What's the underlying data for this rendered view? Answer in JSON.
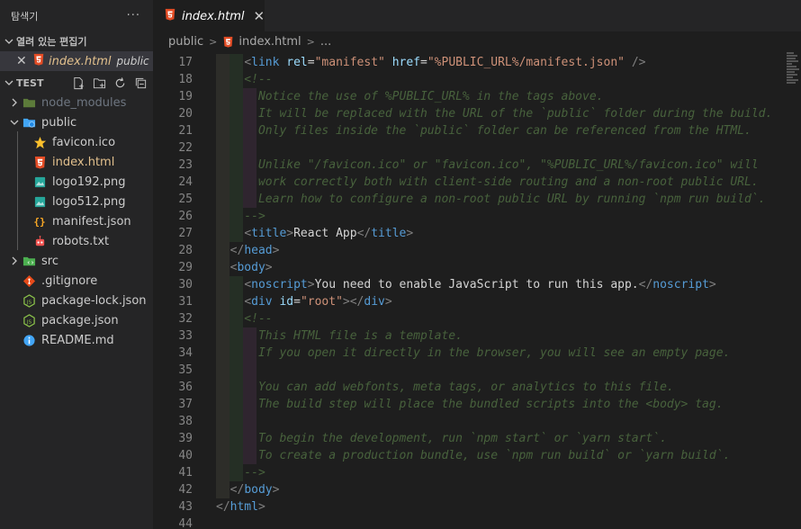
{
  "sidebar": {
    "title": "탐색기",
    "more": "···",
    "open_editors": {
      "label": "열려 있는 편집기",
      "items": [
        {
          "name": "index.html",
          "folder": "public"
        }
      ]
    },
    "workspace": "TEST",
    "tree": [
      {
        "label": "node_modules",
        "type": "folder",
        "expanded": false,
        "dim": true
      },
      {
        "label": "public",
        "type": "folder",
        "expanded": true
      },
      {
        "label": "favicon.ico",
        "type": "favicon"
      },
      {
        "label": "index.html",
        "type": "html",
        "selected": true
      },
      {
        "label": "logo192.png",
        "type": "image"
      },
      {
        "label": "logo512.png",
        "type": "image"
      },
      {
        "label": "manifest.json",
        "type": "json"
      },
      {
        "label": "robots.txt",
        "type": "robots"
      },
      {
        "label": "src",
        "type": "folder",
        "expanded": false
      },
      {
        "label": ".gitignore",
        "type": "git"
      },
      {
        "label": "package-lock.json",
        "type": "node"
      },
      {
        "label": "package.json",
        "type": "node"
      },
      {
        "label": "README.md",
        "type": "info"
      }
    ]
  },
  "editor": {
    "tab": {
      "name": "index.html",
      "close": "✕"
    },
    "breadcrumbs": {
      "folder": "public",
      "file": "index.html",
      "ellipsis": "..."
    },
    "lines": [
      {
        "n": "17",
        "indent": 2,
        "seg": [
          [
            "    ",
            "t"
          ],
          [
            "<",
            "br"
          ],
          [
            "link",
            "tag"
          ],
          [
            " ",
            "t"
          ],
          [
            "rel",
            "attr"
          ],
          [
            "=",
            "t"
          ],
          [
            "\"manifest\"",
            "str"
          ],
          [
            " ",
            "t"
          ],
          [
            "href",
            "attr"
          ],
          [
            "=",
            "t"
          ],
          [
            "\"%PUBLIC_URL%/manifest.json\"",
            "str"
          ],
          [
            " ",
            "t"
          ],
          [
            "/>",
            "br"
          ]
        ]
      },
      {
        "n": "18",
        "indent": 2,
        "seg": [
          [
            "    <!--",
            "cm"
          ]
        ]
      },
      {
        "n": "19",
        "indent": 3,
        "seg": [
          [
            "      Notice the use of %PUBLIC_URL% in the tags above.",
            "cm"
          ]
        ]
      },
      {
        "n": "20",
        "indent": 3,
        "seg": [
          [
            "      It will be replaced with the URL of the `public` folder during the build.",
            "cm"
          ]
        ]
      },
      {
        "n": "21",
        "indent": 3,
        "seg": [
          [
            "      Only files inside the `public` folder can be referenced from the HTML.",
            "cm"
          ]
        ]
      },
      {
        "n": "22",
        "indent": 3,
        "seg": [
          [
            "",
            "t"
          ]
        ]
      },
      {
        "n": "23",
        "indent": 3,
        "seg": [
          [
            "      Unlike \"/favicon.ico\" or \"favicon.ico\", \"%PUBLIC_URL%/favicon.ico\" will",
            "cm"
          ]
        ]
      },
      {
        "n": "24",
        "indent": 3,
        "seg": [
          [
            "      work correctly both with client-side routing and a non-root public URL.",
            "cm"
          ]
        ]
      },
      {
        "n": "25",
        "indent": 3,
        "seg": [
          [
            "      Learn how to configure a non-root public URL by running `npm run build`.",
            "cm"
          ]
        ]
      },
      {
        "n": "26",
        "indent": 2,
        "seg": [
          [
            "    -->",
            "cm"
          ]
        ]
      },
      {
        "n": "27",
        "indent": 2,
        "seg": [
          [
            "    ",
            "t"
          ],
          [
            "<",
            "br"
          ],
          [
            "title",
            "tag"
          ],
          [
            ">",
            "br"
          ],
          [
            "React App",
            "txt"
          ],
          [
            "</",
            "br"
          ],
          [
            "title",
            "tag"
          ],
          [
            ">",
            "br"
          ]
        ]
      },
      {
        "n": "28",
        "indent": 1,
        "seg": [
          [
            "  ",
            "t"
          ],
          [
            "</",
            "br"
          ],
          [
            "head",
            "tag"
          ],
          [
            ">",
            "br"
          ]
        ]
      },
      {
        "n": "29",
        "indent": 1,
        "seg": [
          [
            "  ",
            "t"
          ],
          [
            "<",
            "br"
          ],
          [
            "body",
            "tag"
          ],
          [
            ">",
            "br"
          ]
        ]
      },
      {
        "n": "30",
        "indent": 2,
        "seg": [
          [
            "    ",
            "t"
          ],
          [
            "<",
            "br"
          ],
          [
            "noscript",
            "tag"
          ],
          [
            ">",
            "br"
          ],
          [
            "You need to enable JavaScript to run this app.",
            "txt"
          ],
          [
            "</",
            "br"
          ],
          [
            "noscript",
            "tag"
          ],
          [
            ">",
            "br"
          ]
        ]
      },
      {
        "n": "31",
        "indent": 2,
        "seg": [
          [
            "    ",
            "t"
          ],
          [
            "<",
            "br"
          ],
          [
            "div",
            "tag"
          ],
          [
            " ",
            "t"
          ],
          [
            "id",
            "attr"
          ],
          [
            "=",
            "t"
          ],
          [
            "\"root\"",
            "str"
          ],
          [
            ">",
            "br"
          ],
          [
            "</",
            "br"
          ],
          [
            "div",
            "tag"
          ],
          [
            ">",
            "br"
          ]
        ]
      },
      {
        "n": "32",
        "indent": 2,
        "seg": [
          [
            "    <!--",
            "cm"
          ]
        ]
      },
      {
        "n": "33",
        "indent": 3,
        "seg": [
          [
            "      This HTML file is a template.",
            "cm"
          ]
        ]
      },
      {
        "n": "34",
        "indent": 3,
        "seg": [
          [
            "      If you open it directly in the browser, you will see an empty page.",
            "cm"
          ]
        ]
      },
      {
        "n": "35",
        "indent": 3,
        "seg": [
          [
            "",
            "t"
          ]
        ]
      },
      {
        "n": "36",
        "indent": 3,
        "seg": [
          [
            "      You can add webfonts, meta tags, or analytics to this file.",
            "cm"
          ]
        ]
      },
      {
        "n": "37",
        "indent": 3,
        "seg": [
          [
            "      The build step will place the bundled scripts into the <body> tag.",
            "cm"
          ]
        ]
      },
      {
        "n": "38",
        "indent": 3,
        "seg": [
          [
            "",
            "t"
          ]
        ]
      },
      {
        "n": "39",
        "indent": 3,
        "seg": [
          [
            "      To begin the development, run `npm start` or `yarn start`.",
            "cm"
          ]
        ]
      },
      {
        "n": "40",
        "indent": 3,
        "seg": [
          [
            "      To create a production bundle, use `npm run build` or `yarn build`.",
            "cm"
          ]
        ]
      },
      {
        "n": "41",
        "indent": 2,
        "seg": [
          [
            "    -->",
            "cm"
          ]
        ]
      },
      {
        "n": "42",
        "indent": 1,
        "seg": [
          [
            "  ",
            "t"
          ],
          [
            "</",
            "br"
          ],
          [
            "body",
            "tag"
          ],
          [
            ">",
            "br"
          ]
        ]
      },
      {
        "n": "43",
        "indent": 0,
        "seg": [
          [
            "",
            "t"
          ],
          [
            "</",
            "br"
          ],
          [
            "html",
            "tag"
          ],
          [
            ">",
            "br"
          ]
        ]
      },
      {
        "n": "44",
        "indent": 0,
        "seg": [
          [
            "",
            "t"
          ]
        ]
      }
    ]
  },
  "colors": {
    "tag": "#569cd6",
    "attr": "#9cdcfe",
    "string": "#ce9178",
    "comment": "#6a9955",
    "selected": "#e2c08d"
  }
}
